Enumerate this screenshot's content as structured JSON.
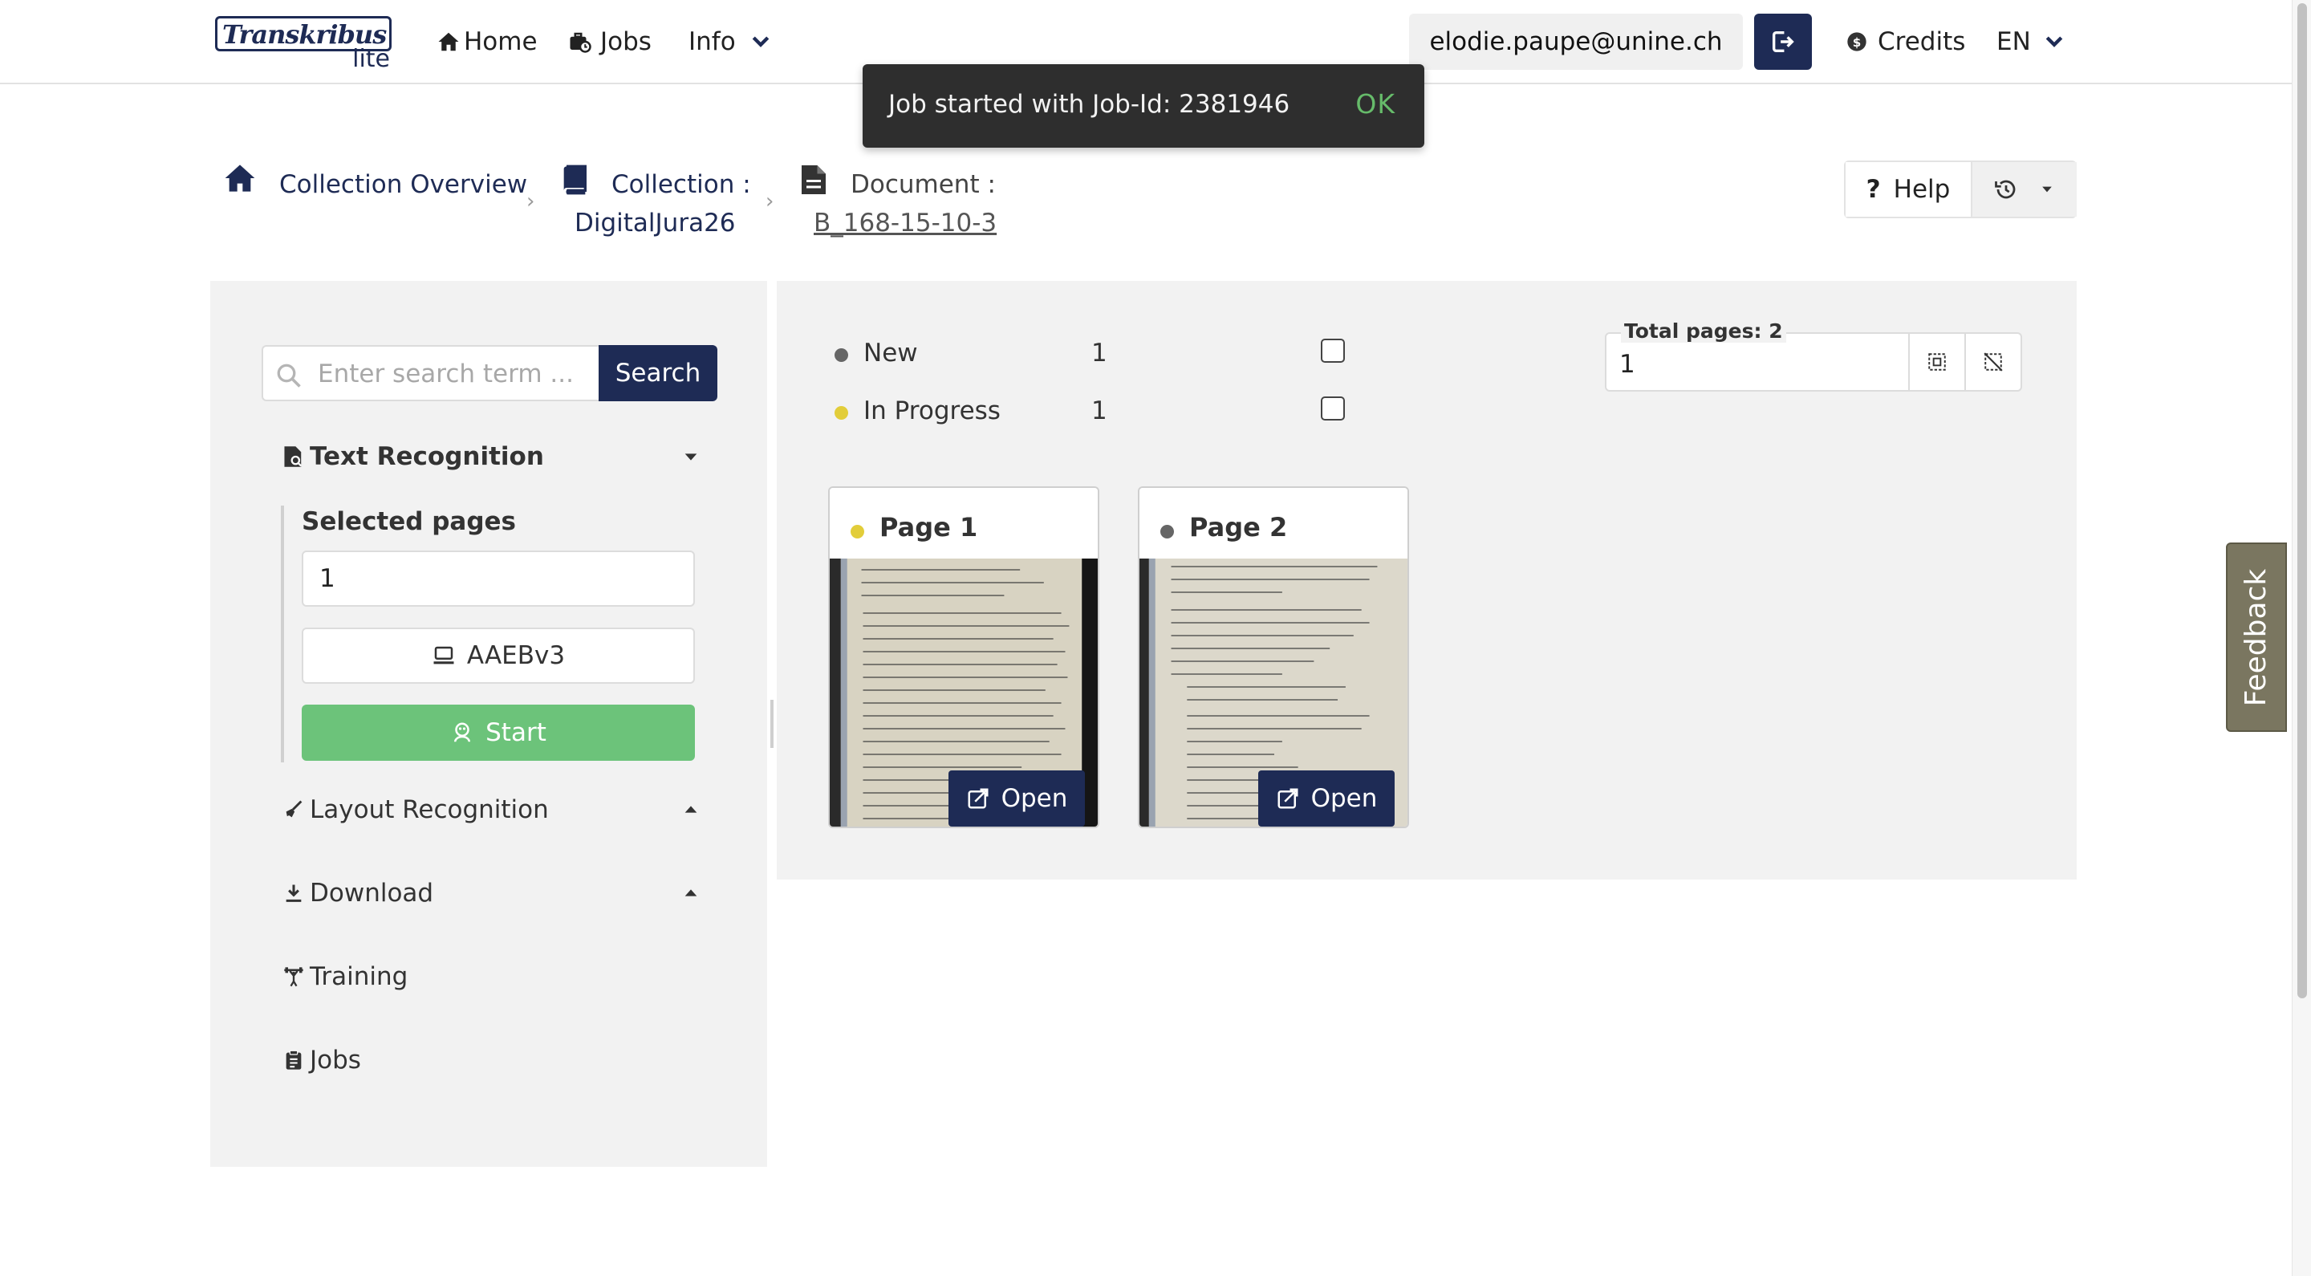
{
  "navbar": {
    "logo_text": "Transkribus",
    "logo_sub": "lite",
    "home": "Home",
    "jobs": "Jobs",
    "info": "Info",
    "user_email": "elodie.paupe@unine.ch",
    "credits": "Credits",
    "language": "EN"
  },
  "toast": {
    "message": "Job started with Job-Id: 2381946",
    "ok": "OK"
  },
  "breadcrumb": {
    "overview": "Collection Overview",
    "collection_label": "Collection :",
    "collection_name": "DigitalJura26",
    "document_label": "Document :",
    "document_name": "B_168-15-10-3"
  },
  "help": {
    "label": "Help"
  },
  "sidebar": {
    "search_placeholder": "Enter search term ...",
    "search_button": "Search",
    "text_recognition": "Text Recognition",
    "selected_pages_label": "Selected pages",
    "selected_pages_value": "1",
    "model": "AAEBv3",
    "start": "Start",
    "layout_recognition": "Layout Recognition",
    "download": "Download",
    "training": "Training",
    "jobs": "Jobs"
  },
  "status": [
    {
      "name": "New",
      "count": "1",
      "color": "#666666"
    },
    {
      "name": "In Progress",
      "count": "1",
      "color": "#e2cd3a"
    }
  ],
  "total_pages": {
    "label": "Total pages: 2",
    "value": "1"
  },
  "pages": [
    {
      "title": "Page 1",
      "status_color": "#e2cd3a",
      "open": "Open"
    },
    {
      "title": "Page 2",
      "status_color": "#666666",
      "open": "Open"
    }
  ],
  "feedback": "Feedback",
  "colors": {
    "navy": "#1e2b55",
    "green": "#6cc37a",
    "toast_bg": "#2e2e2e",
    "panel_bg": "#f2f2f2"
  }
}
